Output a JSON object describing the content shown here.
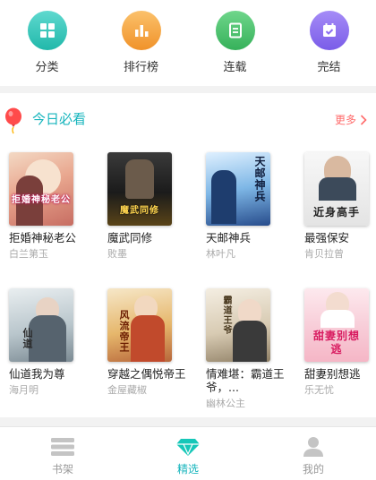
{
  "categories": [
    {
      "label": "分类",
      "icon": "grid-icon",
      "color": "#2bc3b6"
    },
    {
      "label": "排行榜",
      "icon": "bar-chart-icon",
      "color": "#f6a23a"
    },
    {
      "label": "连载",
      "icon": "document-icon",
      "color": "#4cc36a"
    },
    {
      "label": "完结",
      "icon": "calendar-check-icon",
      "color": "#8a6cf0"
    }
  ],
  "section": {
    "title": "今日必看",
    "more_label": "更多",
    "accent": "#17b5bd"
  },
  "books": [
    {
      "title": "拒婚神秘老公",
      "author": "白兰第玉",
      "cover_text": "拒婚神秘老公"
    },
    {
      "title": "魔武同修",
      "author": "败墨",
      "cover_text": "魔武同修"
    },
    {
      "title": "天邮神兵",
      "author": "林叶凡",
      "cover_text": "天邮神兵"
    },
    {
      "title": "最强保安",
      "author": "肯贝拉曾",
      "cover_text": "近身高手"
    },
    {
      "title": "仙道我为尊",
      "author": "海月明",
      "cover_text": "仙道"
    },
    {
      "title": "穿越之偶悦帝王",
      "author": "金屋藏椒",
      "cover_text": "风流帝王"
    },
    {
      "title": "情难堪：霸道王爷，...",
      "author": "幽林公主",
      "cover_text": "霸道王爷"
    },
    {
      "title": "甜妻别想逃",
      "author": "乐无忧",
      "cover_text": "甜妻别想逃"
    }
  ],
  "nav": [
    {
      "label": "书架",
      "icon": "bookshelf-icon",
      "active": false
    },
    {
      "label": "精选",
      "icon": "diamond-icon",
      "active": true
    },
    {
      "label": "我的",
      "icon": "user-icon",
      "active": false
    }
  ]
}
